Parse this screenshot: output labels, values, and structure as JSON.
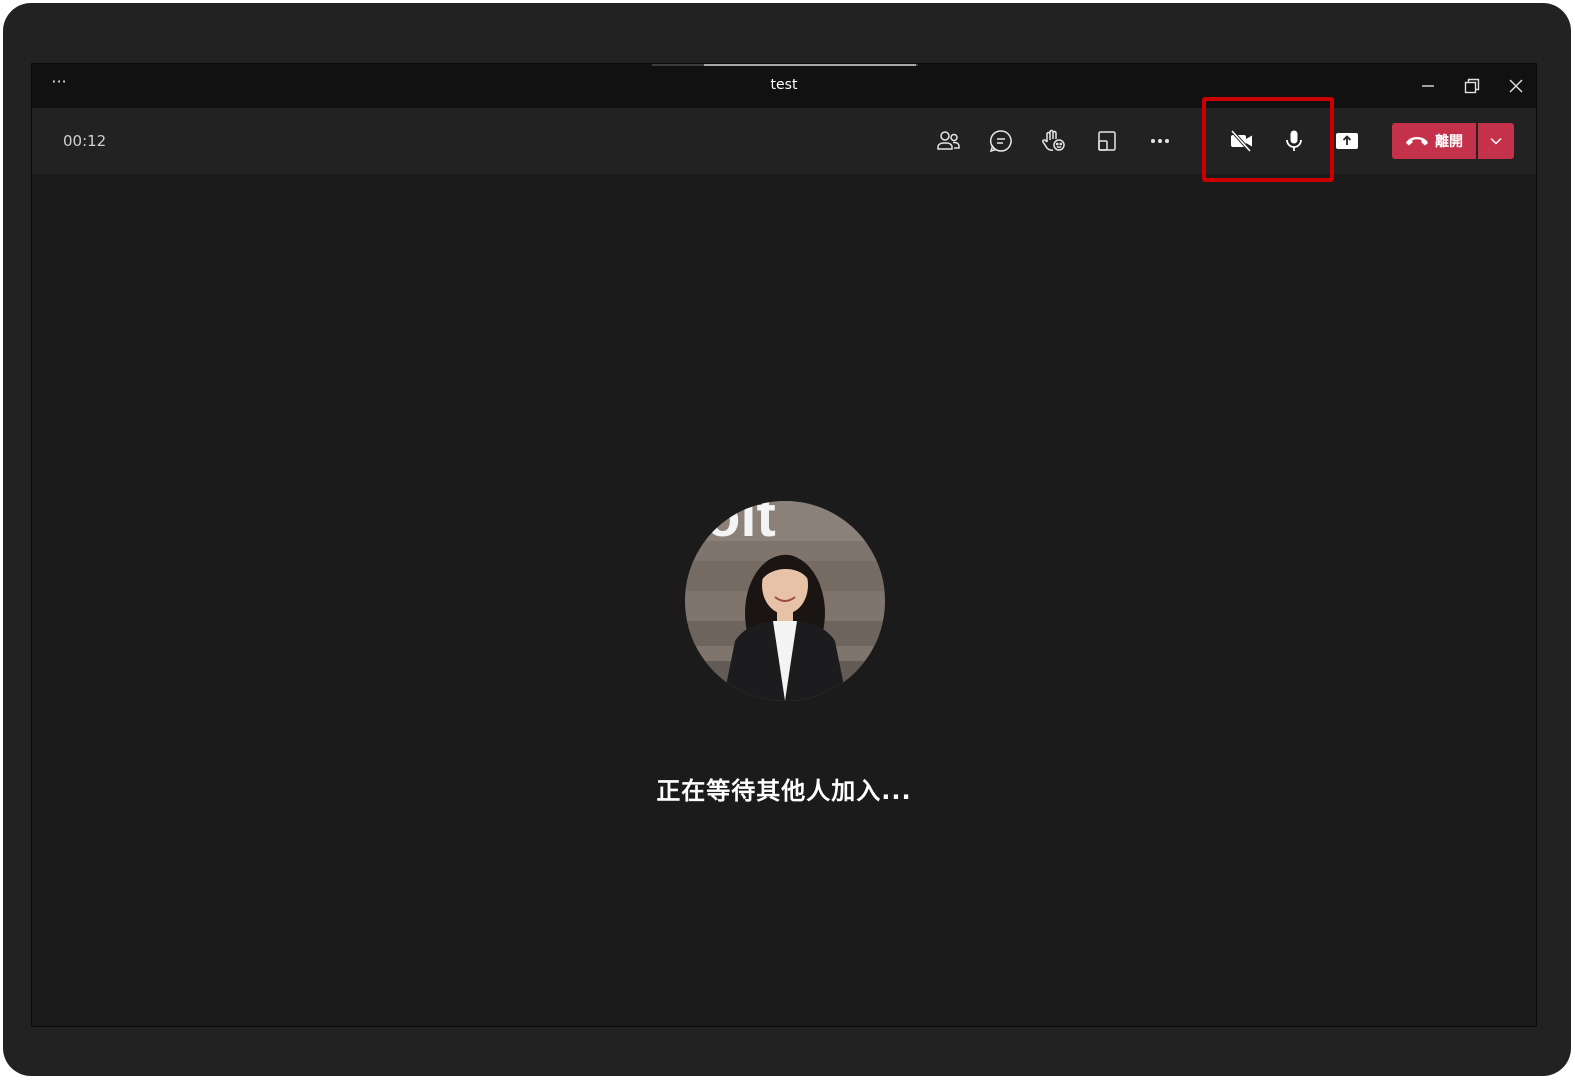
{
  "window": {
    "title": "test",
    "menu_icon": "more-horizontal-icon",
    "controls": [
      "minimize-icon",
      "restore-icon",
      "close-icon"
    ]
  },
  "toolbar": {
    "timer": "00:12",
    "buttons": [
      {
        "name": "participants",
        "icon": "people-icon"
      },
      {
        "name": "chat",
        "icon": "chat-icon"
      },
      {
        "name": "reactions",
        "icon": "raise-hand-icon"
      },
      {
        "name": "view",
        "icon": "window-layout-icon"
      },
      {
        "name": "more",
        "icon": "more-horizontal-icon"
      },
      {
        "name": "camera",
        "icon": "camera-off-icon"
      },
      {
        "name": "microphone",
        "icon": "microphone-icon"
      },
      {
        "name": "share",
        "icon": "share-screen-icon"
      }
    ],
    "leave_label": "離開",
    "leave_icon": "phone-hangup-icon",
    "leave_dropdown_icon": "chevron-down-icon",
    "highlight_color": "#cc0000",
    "leave_color": "#c4314b"
  },
  "stage": {
    "waiting_message": "正在等待其他人加入..."
  },
  "colors": {
    "window_bg": "#1b1b1b",
    "title_bar_bg": "#111111",
    "toolbar_bg": "#222222"
  }
}
